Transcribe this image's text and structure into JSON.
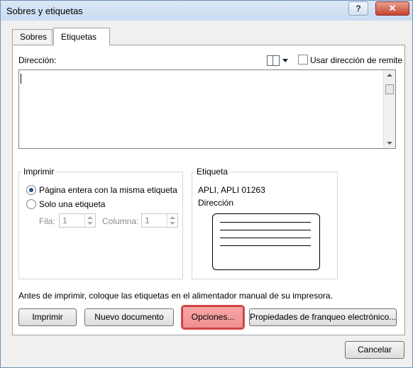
{
  "window": {
    "title": "Sobres y etiquetas",
    "help_label": "?",
    "close_label": "✕"
  },
  "tabs": [
    {
      "label": "Sobres",
      "selected": false
    },
    {
      "label": "Etiquetas",
      "selected": true
    }
  ],
  "address": {
    "label": "Dirección:",
    "value": "",
    "address_book_icon": "address-book-icon",
    "use_return_address_label": "Usar dirección de remite",
    "use_return_address_checked": false
  },
  "print_group": {
    "legend": "Imprimir",
    "option_full_page": "Página entera con la misma etiqueta",
    "option_single": "Solo una etiqueta",
    "selected": "full_page",
    "row_label": "Fila:",
    "row_value": "1",
    "column_label": "Columna:",
    "column_value": "1"
  },
  "label_group": {
    "legend": "Etiqueta",
    "product": "APLI, APLI 01263",
    "type": "Dirección"
  },
  "instruction": "Antes de imprimir, coloque las etiquetas en el alimentador manual de su impresora.",
  "buttons": {
    "print": "Imprimir",
    "new_document": "Nuevo documento",
    "options": "Opciones...",
    "postage_properties": "Propiedades de franqueo electrónico...",
    "cancel": "Cancelar"
  },
  "colors": {
    "focus_button": "#ef8f8f",
    "title_bar": "#c9dcf2",
    "close_button": "#c8412e"
  }
}
